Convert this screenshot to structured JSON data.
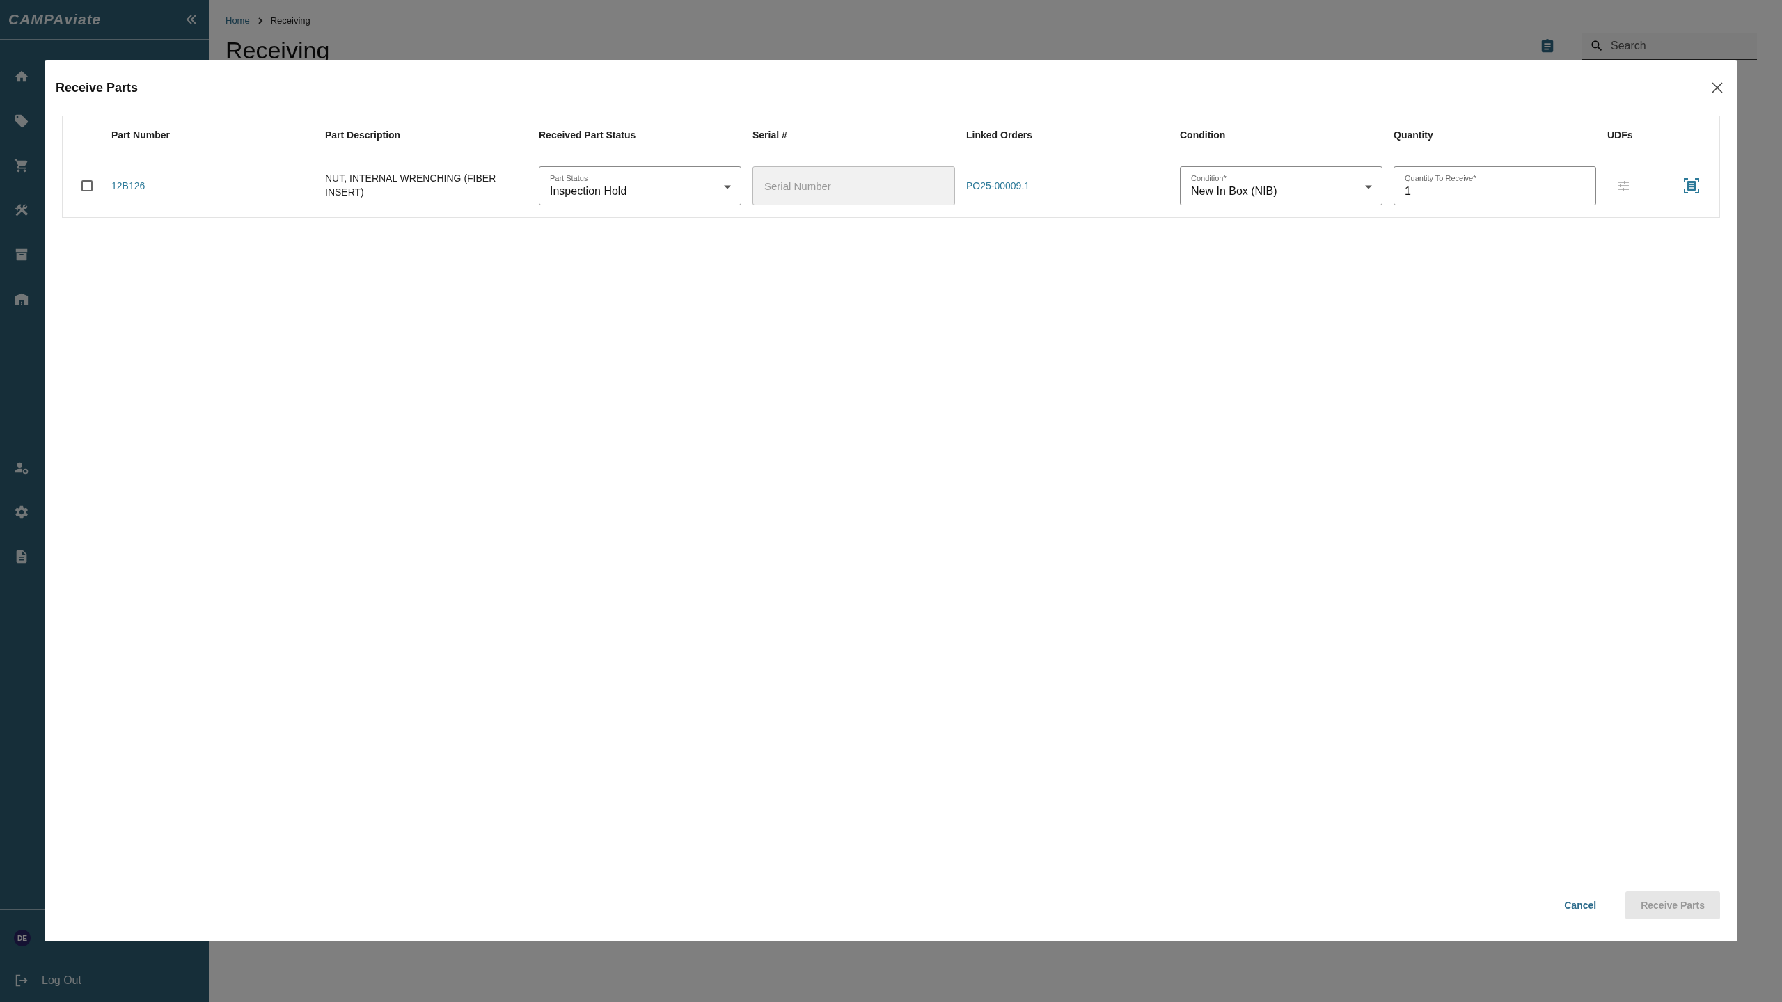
{
  "sidebar": {
    "logo": "CAMPAviate",
    "user_initials": "DE",
    "logout": "Log Out"
  },
  "breadcrumb": [
    "Home",
    "Receiving"
  ],
  "page_title": "Receiving",
  "search": {
    "placeholder": "Search"
  },
  "dialog": {
    "title": "Receive Parts",
    "columns": [
      "Part Number",
      "Part Description",
      "Received Part Status",
      "Serial #",
      "Linked Orders",
      "Condition",
      "Quantity",
      "UDFs"
    ],
    "rows": [
      {
        "checked": false,
        "part_number": "12B126",
        "description": "NUT, INTERNAL WRENCHING (FIBER INSERT)",
        "part_status": {
          "label": "Part Status",
          "value": "Inspection Hold"
        },
        "serial": {
          "placeholder": "Serial Number",
          "disabled": true
        },
        "linked_order": "PO25-00009.1",
        "condition": {
          "label": "Condition*",
          "value": "New In Box (NIB)"
        },
        "quantity": {
          "label": "Quantity To Receive*",
          "value": "1"
        }
      }
    ],
    "buttons": [
      {
        "label": "Cancel",
        "kind": "text",
        "disabled": false
      },
      {
        "label": "Receive Parts",
        "kind": "filled",
        "disabled": true
      }
    ]
  }
}
